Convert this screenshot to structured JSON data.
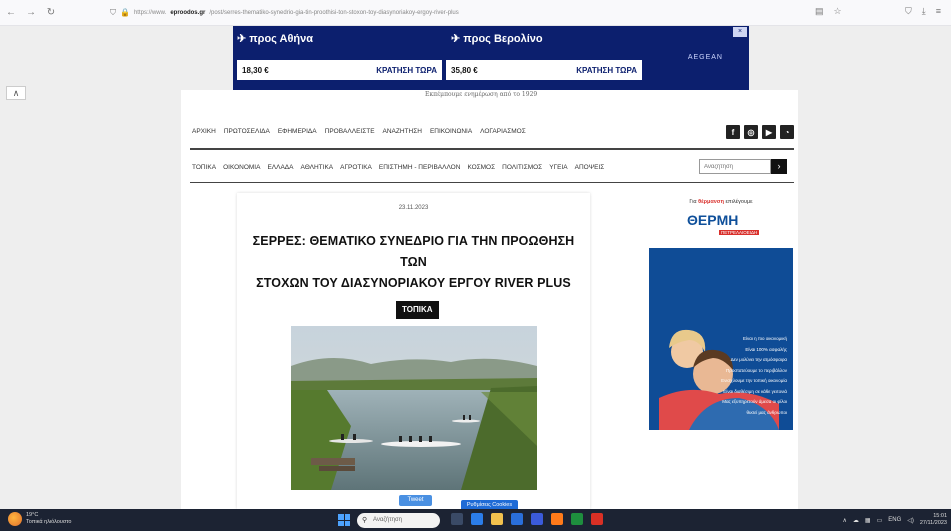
{
  "browser": {
    "url_prefix": "https://www.",
    "url_host": "eproodos.gr",
    "url_path": "/post/serres-thematiko-synedrio-gia-tin-proothisi-ton-stoxon-toy-diasynoriakoy-ergoy-river-plus",
    "icons": [
      "back-icon",
      "forward-icon",
      "reload-icon",
      "reader-icon",
      "bookmark-star-icon",
      "shield-icon",
      "download-icon",
      "menu-icon"
    ]
  },
  "ad_banner": {
    "dest1": "προς Αθήνα",
    "price1": "18,30 €",
    "book1": "ΚΡΑΤΗΣΗ ΤΩΡΑ",
    "dest2": "προς Βερολίνο",
    "price2": "35,80 €",
    "book2": "ΚΡΑΤΗΣΗ ΤΩΡΑ",
    "brand": "AEGEAN",
    "close": "×",
    "color": "#0c1f6e"
  },
  "tagline": "Εκπέμπουμε ενημέρωση από το 1929",
  "menu_top": [
    "ΑΡΧΙΚΗ",
    "ΠΡΩΤΟΣΕΛΙΔΑ",
    "ΕΦΗΜΕΡΙΔΑ",
    "ΠΡΟΒΑΛΛΕΙΣΤΕ",
    "ΑΝΑΖΗΤΗΣΗ",
    "ΕΠΙΚΟΙΝΩΝΙΑ",
    "ΛΟΓΑΡΙΑΣΜΟΣ"
  ],
  "social_icons": [
    "facebook-icon",
    "instagram-icon",
    "youtube-icon",
    "rss-icon"
  ],
  "menu_sections": [
    "ΤΟΠΙΚΑ",
    "ΟΙΚΟΝΟΜΙΑ",
    "ΕΛΛΑΔΑ",
    "ΑΘΛΗΤΙΚΑ",
    "ΑΓΡΟΤΙΚΑ",
    "ΕΠΙΣΤΗΜΗ - ΠΕΡΙΒΑΛΛΟΝ",
    "ΚΟΣΜΟΣ",
    "ΠΟΛΙΤΙΣΜΟΣ",
    "ΥΓΕΙΑ",
    "ΑΠΟΨΕΙΣ"
  ],
  "site_search": {
    "placeholder": "Αναζήτηση",
    "button": "›"
  },
  "article": {
    "date": "23.11.2023",
    "title_line1": "ΣΕΡΡΕΣ: ΘΕΜΑΤΙΚΟ ΣΥΝΕΔΡΙΟ ΓΙΑ ΤΗΝ ΠΡΟΩΘΗΣΗ ΤΩΝ",
    "title_line2": "ΣΤΟΧΩΝ ΤΟΥ ΔΙΑΣΥΝΟΡΙΑΚΟΥ ΕΡΓΟΥ RIVER PLUS",
    "category": "ΤΟΠΙΚΑ",
    "tweet": "Tweet"
  },
  "side_ad": {
    "slogan_pre": "Για",
    "slogan_hl": "θέρμανση",
    "slogan_post": "επιλέγουμε",
    "logo": "ΘΕΡΜΗ",
    "logo_sub": "ΠΕΤΡΕΛΑΙΟΕΙΔΗ",
    "lines": [
      "Είναι η πιο οικονομική",
      "Είναι 100% ασφαλής",
      "Δεν μολύνει την ατμόσφαιρα",
      "Προστατεύουμε το περιβάλλον",
      "Ενισχύουμε την τοπική οικονομία",
      "Είναι διαθέσιμη σε κάθε γειτονιά",
      "Μας εξυπηρετούν άμεσα οι φίλοι",
      "θυσεί μας άνθρωποι"
    ]
  },
  "cookies_button": "Ρυθμίσεις Cookies",
  "taskbar": {
    "weather_temp": "19°C",
    "weather_desc": "Τοπικά ηλιόλουστο",
    "search_placeholder": "Αναζήτηση",
    "lang": "ENG",
    "time": "15:01",
    "date": "27/11/2023"
  }
}
